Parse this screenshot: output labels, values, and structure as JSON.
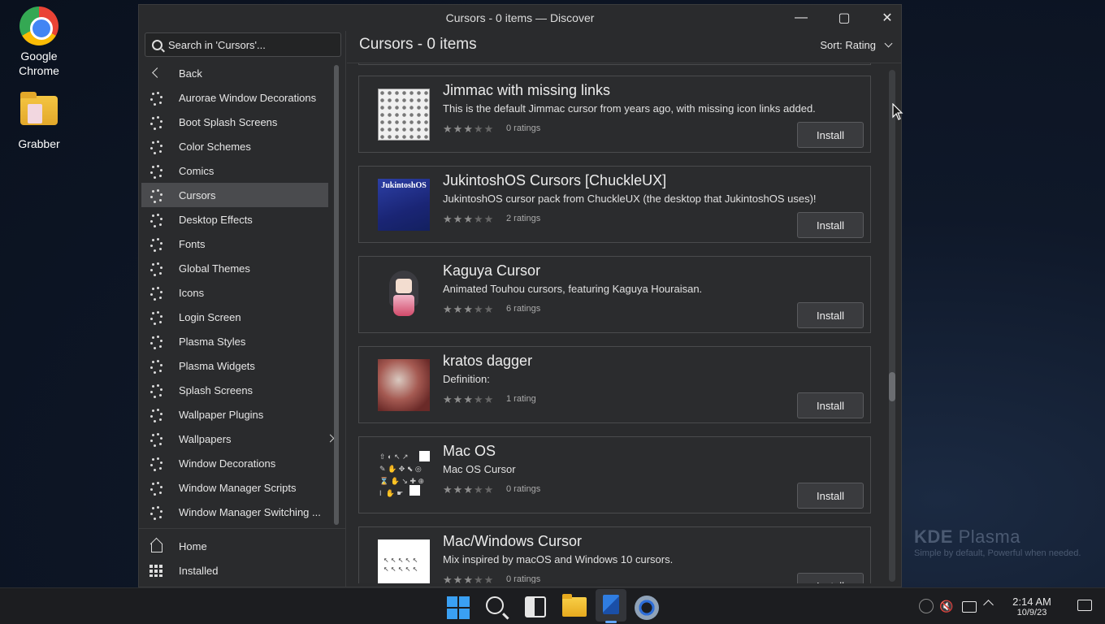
{
  "desktop": {
    "icons": [
      {
        "label": "Google\nChrome"
      },
      {
        "label": "Grabber"
      }
    ]
  },
  "window": {
    "title": "Cursors - 0 items — Discover",
    "controls": {
      "minimize": "—",
      "maximize": "▢",
      "close": "✕"
    }
  },
  "sidebar": {
    "search_placeholder": "Search in 'Cursors'...",
    "back_label": "Back",
    "items": [
      {
        "label": "Aurorae Window Decorations"
      },
      {
        "label": "Boot Splash Screens"
      },
      {
        "label": "Color Schemes"
      },
      {
        "label": "Comics"
      },
      {
        "label": "Cursors",
        "active": true
      },
      {
        "label": "Desktop Effects"
      },
      {
        "label": "Fonts"
      },
      {
        "label": "Global Themes"
      },
      {
        "label": "Icons"
      },
      {
        "label": "Login Screen"
      },
      {
        "label": "Plasma Styles"
      },
      {
        "label": "Plasma Widgets"
      },
      {
        "label": "Splash Screens"
      },
      {
        "label": "Wallpaper Plugins"
      },
      {
        "label": "Wallpapers",
        "has_submenu": true
      },
      {
        "label": "Window Decorations"
      },
      {
        "label": "Window Manager Scripts"
      },
      {
        "label": "Window Manager Switching ..."
      }
    ],
    "bottom": {
      "home": "Home",
      "installed": "Installed"
    }
  },
  "main": {
    "title": "Cursors - 0 items",
    "sort_label": "Sort: Rating",
    "install_label": "Install",
    "items": [
      {
        "name": "Jimmac with missing links",
        "description": "This is the default Jimmac cursor from years ago, with missing icon links added.",
        "ratings": "0 ratings",
        "stars": 0
      },
      {
        "name": "JukintoshOS Cursors [ChuckleUX]",
        "description": "JukintoshOS cursor pack from ChuckleUX (the desktop that JukintoshOS uses)!",
        "ratings": "2 ratings",
        "stars": 0,
        "thumb_text": "JukintoshOS"
      },
      {
        "name": "Kaguya Cursor",
        "description": "Animated Touhou cursors, featuring Kaguya Houraisan.",
        "ratings": "6 ratings",
        "stars": 0
      },
      {
        "name": "kratos dagger",
        "description": "Definition:",
        "ratings": "1 rating",
        "stars": 0
      },
      {
        "name": "Mac OS",
        "description": "Mac OS Cursor",
        "ratings": "0 ratings",
        "stars": 0
      },
      {
        "name": "Mac/Windows Cursor",
        "description": "Mix inspired by macOS and Windows 10 cursors.",
        "ratings": "0 ratings",
        "stars": 0
      }
    ]
  },
  "watermark": {
    "brand": "KDE",
    "product": "Plasma",
    "tagline": "Simple by default, Powerful when  needed."
  },
  "taskbar": {
    "time": "2:14 AM",
    "date": "10/9/23"
  },
  "colors": {
    "accent": "#3aa0f3",
    "window_bg": "#2a2b2d",
    "active_item": "#4a4b4e"
  }
}
